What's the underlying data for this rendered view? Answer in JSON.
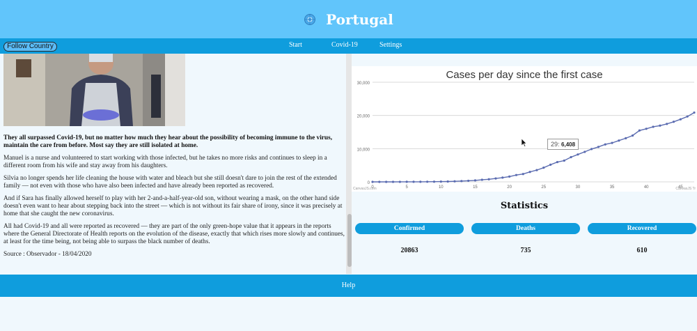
{
  "header": {
    "title": "Portugal",
    "icon": "globe-icon"
  },
  "nav": {
    "follow_label": "Follow Country",
    "links": [
      "Start",
      "Covid-19",
      "Settings"
    ]
  },
  "article": {
    "lead": "They all surpassed Covid-19, but no matter how much they hear about the possibility of becoming immune to the virus, maintain the care from before. Most say they are still isolated at home.",
    "paragraphs": [
      "Manuel is a nurse and volunteered to start working with those infected, but he takes no more risks and continues to sleep in a different room from his wife and stay away from his daughters.",
      "Silvia no longer spends her life cleaning the house with water and bleach but she still doesn't dare to join the rest of the extended family — not even with those who have also been infected and have already been reported as recovered.",
      "And if Sara has finally allowed herself to play with her 2-and-a-half-year-old son, without wearing a mask, on the other hand side doesn't even want to hear about stepping back into the street — which is not without its fair share of irony, since it was precisely at home that she caught the new coronavirus.",
      "All had Covid-19 and all were reported as recovered — they are part of the only green-hope value that it appears in the reports where the General Directorate of Health reports on the evolution of the disease, exactly that which rises more slowly and continues, at least for the time being, not being able to surpass the black number of deaths."
    ],
    "source": "Source : Observador - 18/04/2020"
  },
  "chart_data": {
    "type": "line",
    "title": "Cases per day since the first case",
    "xlabel": "",
    "ylabel": "",
    "ylim": [
      0,
      30000
    ],
    "xlim": [
      0,
      47
    ],
    "yticks": [
      0,
      10000,
      20000,
      30000
    ],
    "ytick_labels": [
      "0",
      "10,000",
      "20,000",
      "30,000"
    ],
    "xticks": [
      0,
      5,
      10,
      15,
      20,
      25,
      30,
      35,
      40,
      45
    ],
    "grid": true,
    "series": [
      {
        "color": "#5a6bb0",
        "x": [
          0,
          1,
          2,
          3,
          4,
          5,
          6,
          7,
          8,
          9,
          10,
          11,
          12,
          13,
          14,
          15,
          16,
          17,
          18,
          19,
          20,
          21,
          22,
          23,
          24,
          25,
          26,
          27,
          28,
          29,
          30,
          31,
          32,
          33,
          34,
          35,
          36,
          37,
          38,
          39,
          40,
          41,
          42,
          43,
          44,
          45,
          46,
          47
        ],
        "values": [
          2,
          4,
          6,
          9,
          13,
          21,
          30,
          30,
          41,
          59,
          78,
          112,
          169,
          245,
          331,
          448,
          642,
          785,
          1020,
          1280,
          1600,
          2060,
          2362,
          2995,
          3544,
          4268,
          5170,
          5962,
          6408,
          7443,
          8251,
          9034,
          9886,
          10524,
          11278,
          11730,
          12442,
          13141,
          13956,
          15472,
          15987,
          16585,
          16934,
          17448,
          18091,
          18841,
          19685,
          20863
        ]
      }
    ],
    "tooltip": {
      "label": "29:",
      "value": "6,408"
    },
    "credits": [
      "CanvasJS.com",
      "CanvasJS Tr"
    ]
  },
  "stats": {
    "title": "Statistics",
    "items": [
      {
        "label": "Confirmed",
        "value": "20863"
      },
      {
        "label": "Deaths",
        "value": "735"
      },
      {
        "label": "Recovered",
        "value": "610"
      }
    ]
  },
  "footer": {
    "help": "Help"
  }
}
